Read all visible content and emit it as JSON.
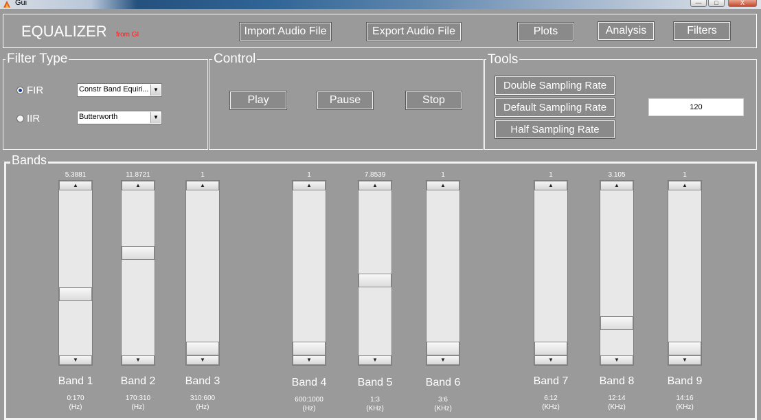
{
  "window": {
    "title": "Gui",
    "min": "—",
    "max": "□",
    "close": "X"
  },
  "header": {
    "title": "EQUALIZER",
    "subtitle": "from GI",
    "buttons": {
      "import": "Import Audio File",
      "export": "Export Audio File",
      "plots": "Plots",
      "analysis": "Analysis",
      "filters": "Filters"
    }
  },
  "filter_type": {
    "title": "Filter Type",
    "fir_label": "FIR",
    "iir_label": "IIR",
    "fir_selected": true,
    "fir_select": "Constr Band Equiri...",
    "iir_select": "Butterworth"
  },
  "control": {
    "title": "Control",
    "play": "Play",
    "pause": "Pause",
    "stop": "Stop"
  },
  "tools": {
    "title": "Tools",
    "double": "Double Sampling Rate",
    "default": "Default Sampling Rate",
    "half": "Half Sampling Rate",
    "rate_value": "120"
  },
  "bands": {
    "title": "Bands",
    "items": [
      {
        "name": "Band 1",
        "value": "5.3881",
        "range": "0:170",
        "unit": "(Hz)",
        "level": 0.36
      },
      {
        "name": "Band 2",
        "value": "11.8721",
        "range": "170:310",
        "unit": "(Hz)",
        "level": 0.63
      },
      {
        "name": "Band 3",
        "value": "1",
        "range": "310:600",
        "unit": "(Hz)",
        "level": 0.0
      },
      {
        "name": "Band 4",
        "value": "1",
        "range": "600:1000",
        "unit": "(Hz)",
        "level": 0.0
      },
      {
        "name": "Band 5",
        "value": "7.8539",
        "range": "1:3",
        "unit": "(KHz)",
        "level": 0.45
      },
      {
        "name": "Band 6",
        "value": "1",
        "range": "3:6",
        "unit": "(KHz)",
        "level": 0.0
      },
      {
        "name": "Band 7",
        "value": "1",
        "range": "6:12",
        "unit": "(KHz)",
        "level": 0.0
      },
      {
        "name": "Band 8",
        "value": "3.105",
        "range": "12:14",
        "unit": "(KHz)",
        "level": 0.17
      },
      {
        "name": "Band 9",
        "value": "1",
        "range": "14:16",
        "unit": "(KHz)",
        "level": 0.0
      }
    ]
  }
}
